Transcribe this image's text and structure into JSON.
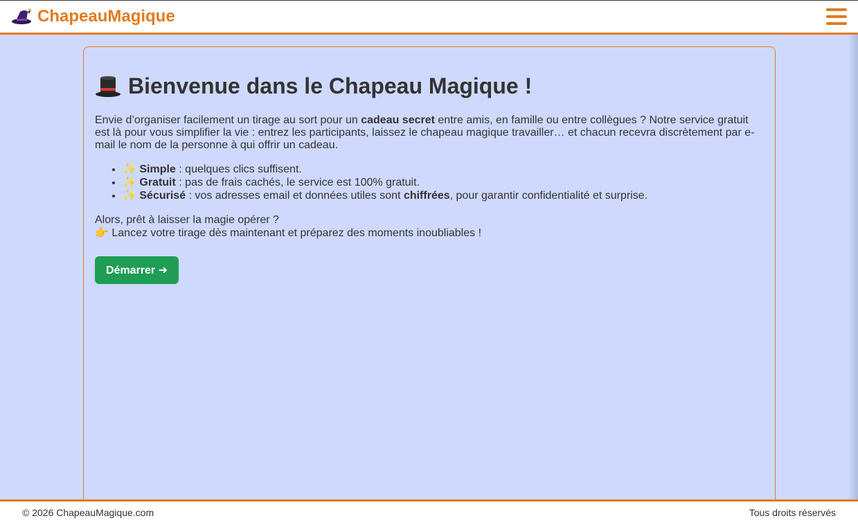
{
  "header": {
    "brand": "ChapeauMagique",
    "logo_icon": "wizard-hat-icon",
    "menu_icon": "hamburger-menu-icon",
    "accent_color": "#e07b22"
  },
  "main": {
    "title": "Bienvenue dans le Chapeau Magique !",
    "title_icon": "top-hat-icon",
    "intro_before": "Envie d’organiser facilement un tirage au sort pour un ",
    "intro_bold": "cadeau secret",
    "intro_after": " entre amis, en famille ou entre collègues ? Notre service gratuit est là pour vous simplifier la vie : entrez les participants, laissez le chapeau magique travailler… et chacun recevra discrètement par e-mail le nom de la personne à qui offrir un cadeau.",
    "features": [
      {
        "icon": "✨",
        "label": "Simple",
        "text": " : quelques clics suffisent."
      },
      {
        "icon": "✨",
        "label": "Gratuit",
        "text": " : pas de frais cachés, le service est 100% gratuit."
      },
      {
        "icon": "✨",
        "label": "Sécurisé",
        "text_before": " : vos adresses email et données utiles sont ",
        "text_bold": "chiffrées",
        "text_after": ", pour garantir confidentialité et surprise."
      }
    ],
    "outro_line1": "Alors, prêt à laisser la magie opérer ?",
    "outro_icon": "👉",
    "outro_line2": " Lancez votre tirage dès maintenant et préparez des moments inoubliables !",
    "start_button": "Démarrer ➜",
    "button_color": "#1f9d55"
  },
  "footer": {
    "copyright": "© 2026 ChapeauMagique.com",
    "rights": "Tous droits réservés"
  }
}
